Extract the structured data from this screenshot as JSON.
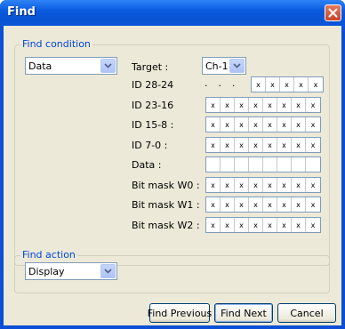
{
  "window": {
    "title": "Find"
  },
  "find_condition": {
    "legend": "Find condition",
    "type_select": {
      "value": "Data"
    },
    "target_label": "Target :",
    "target_select": {
      "value": "Ch-1"
    },
    "rows": [
      {
        "label": "ID 28-24",
        "prefix": [
          ".",
          ".",
          "."
        ],
        "bits": [
          "x",
          "x",
          "x",
          "x",
          "x"
        ]
      },
      {
        "label": "ID 23-16",
        "bits": [
          "x",
          "x",
          "x",
          "x",
          "x",
          "x",
          "x",
          "x"
        ]
      },
      {
        "label": "ID 15-8 :",
        "bits": [
          "x",
          "x",
          "x",
          "x",
          "x",
          "x",
          "x",
          "x"
        ]
      },
      {
        "label": "ID 7-0 :",
        "bits": [
          "x",
          "x",
          "x",
          "x",
          "x",
          "x",
          "x",
          "x"
        ]
      },
      {
        "label": "Data :",
        "bits": [
          "",
          "",
          "",
          "",
          "",
          "",
          "",
          ""
        ]
      },
      {
        "label": "Bit mask W0 :",
        "bits": [
          "x",
          "x",
          "x",
          "x",
          "x",
          "x",
          "x",
          "x"
        ]
      },
      {
        "label": "Bit mask W1 :",
        "bits": [
          "x",
          "x",
          "x",
          "x",
          "x",
          "x",
          "x",
          "x"
        ]
      },
      {
        "label": "Bit mask W2 :",
        "bits": [
          "x",
          "x",
          "x",
          "x",
          "x",
          "x",
          "x",
          "x"
        ]
      }
    ]
  },
  "find_action": {
    "legend": "Find action",
    "action_select": {
      "value": "Display"
    }
  },
  "buttons": {
    "find_previous": "Find Previous",
    "find_next": "Find Next",
    "cancel": "Cancel"
  },
  "icons": {
    "close": "close-icon",
    "dropdown": "chevron-down-icon"
  },
  "colors": {
    "title_bar": "#0a55d8",
    "legend_text": "#0046d5",
    "dialog_bg": "#ece9d8"
  }
}
